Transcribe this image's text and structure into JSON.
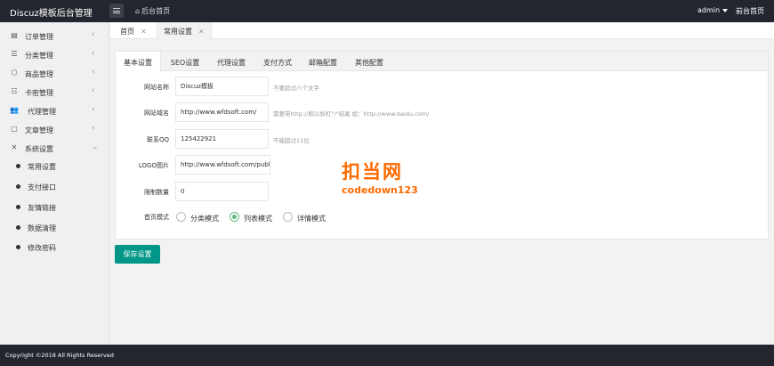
{
  "header": {
    "brand": "Discuz模板后台管理",
    "home_link": "后台首页",
    "home_icon": "⌂",
    "user": "admin",
    "front_link": "前台首页"
  },
  "sidebar": {
    "items": [
      {
        "label": "订单管理",
        "icon": "▤",
        "chevron": "‹"
      },
      {
        "label": "分类管理",
        "icon": "☰",
        "chevron": "‹"
      },
      {
        "label": "商品管理",
        "icon": "⬡",
        "chevron": "‹"
      },
      {
        "label": "卡密管理",
        "icon": "☷",
        "chevron": "‹"
      },
      {
        "label": "代理管理",
        "icon": "👥",
        "chevron": "‹"
      },
      {
        "label": "文章管理",
        "icon": "▢",
        "chevron": "‹"
      },
      {
        "label": "系统设置",
        "icon": "✕",
        "chevron": "⌄"
      }
    ],
    "sub_items": [
      {
        "label": "常用设置"
      },
      {
        "label": "支付接口"
      },
      {
        "label": "友情链接"
      },
      {
        "label": "数据清理"
      },
      {
        "label": "修改密码"
      }
    ]
  },
  "page_tabs": [
    {
      "label": "首页",
      "close": "✕"
    },
    {
      "label": "常用设置",
      "close": "✕"
    }
  ],
  "settings_tabs": [
    "基本设置",
    "SEO设置",
    "代理设置",
    "支付方式",
    "邮箱配置",
    "其他配置"
  ],
  "form": {
    "site_name": {
      "label": "网站名称",
      "value": "Discuz模板",
      "hint": "不要超过八个文字"
    },
    "site_url": {
      "label": "网站域名",
      "value": "http://www.wfdsoft.com/",
      "hint": "需要带http://和以斜杠\"/\"结尾 如：http://www.baidu.com/"
    },
    "qq": {
      "label": "联系QQ",
      "value": "125422921",
      "hint": "不能超过11位"
    },
    "logo": {
      "label": "LOGO图片",
      "value": "http://www.wfdsoft.com/public/sta"
    },
    "limit": {
      "label": "限制数量",
      "value": "0"
    },
    "home_mode": {
      "label": "首页模式",
      "options": [
        "分类模式",
        "列表模式",
        "详情模式"
      ],
      "selected": "列表模式"
    }
  },
  "save_button": "保存设置",
  "watermark": {
    "title": "扣当网",
    "subtitle": "codedown123"
  },
  "footer": "Copyright ©2018 All Rights Reserved",
  "colors": {
    "topbar": "#23262e",
    "accent": "#009688",
    "radio_on": "#5fb878",
    "watermark": "#ff6a00"
  }
}
